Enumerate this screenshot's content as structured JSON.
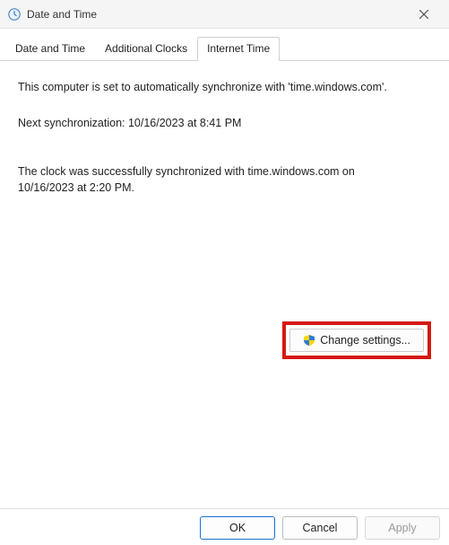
{
  "window": {
    "title": "Date and Time"
  },
  "tabs": [
    {
      "label": "Date and Time",
      "active": false
    },
    {
      "label": "Additional Clocks",
      "active": false
    },
    {
      "label": "Internet Time",
      "active": true
    }
  ],
  "body": {
    "sync_text": "This computer is set to automatically synchronize with 'time.windows.com'.",
    "next_sync": "Next synchronization: 10/16/2023 at 8:41 PM",
    "last_sync": "The clock was successfully synchronized with time.windows.com on 10/16/2023 at 2:20 PM.",
    "change_button": "Change settings..."
  },
  "footer": {
    "ok": "OK",
    "cancel": "Cancel",
    "apply": "Apply"
  }
}
